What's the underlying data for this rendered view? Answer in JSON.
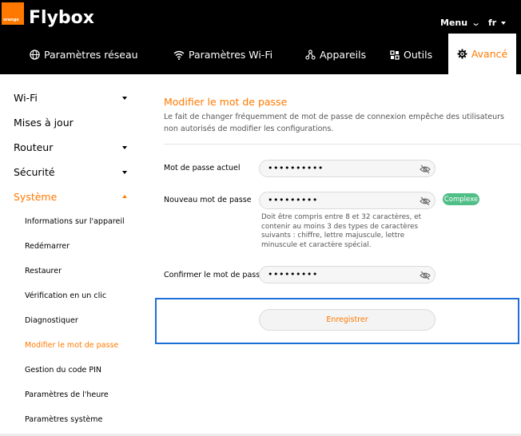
{
  "header": {
    "logo_text": "orange",
    "brand": "Flybox",
    "menu_label": "Menu",
    "lang_label": "fr",
    "accent_color": "#ff7900"
  },
  "nav": {
    "items": [
      {
        "label": "Paramètres réseau",
        "icon": "globe-icon"
      },
      {
        "label": "Paramètres Wi-Fi",
        "icon": "wifi-icon"
      },
      {
        "label": "Appareils",
        "icon": "devices-icon"
      },
      {
        "label": "Outils",
        "icon": "tools-icon"
      },
      {
        "label": "Avancé",
        "icon": "gear-icon",
        "active": true
      }
    ]
  },
  "sidebar": {
    "items": [
      {
        "label": "Wi-Fi",
        "expandable": true
      },
      {
        "label": "Mises à jour",
        "expandable": false
      },
      {
        "label": "Routeur",
        "expandable": true
      },
      {
        "label": "Sécurité",
        "expandable": true
      },
      {
        "label": "Système",
        "expandable": true,
        "expanded": true,
        "active": true
      }
    ],
    "sub_items": [
      {
        "label": "Informations sur l'appareil"
      },
      {
        "label": "Redémarrer"
      },
      {
        "label": "Restaurer"
      },
      {
        "label": "Vérification en un clic"
      },
      {
        "label": "Diagnostiquer"
      },
      {
        "label": "Modifier le mot de passe",
        "active": true
      },
      {
        "label": "Gestion du code PIN"
      },
      {
        "label": "Paramètres de l'heure"
      },
      {
        "label": "Paramètres système"
      }
    ]
  },
  "main": {
    "title": "Modifier le mot de passe",
    "description": "Le fait de changer fréquemment de mot de passe de connexion empêche des utilisateurs non autorisés de modifier les configurations.",
    "fields": {
      "current": {
        "label": "Mot de passe actuel",
        "value": "••••••••••"
      },
      "new": {
        "label": "Nouveau mot de passe",
        "value": "•••••••••"
      },
      "confirm": {
        "label": "Confirmer le mot de passe",
        "value": "•••••••••"
      }
    },
    "strength_badge": "Complexe",
    "strength_color": "#50be87",
    "hint": "Doit être compris entre 8 et 32 caractères, et contenir au moins 3 des types de caractères suivants : chiffre, lettre majuscule, lettre minuscule et caractère spécial.",
    "save_label": "Enregistrer"
  }
}
